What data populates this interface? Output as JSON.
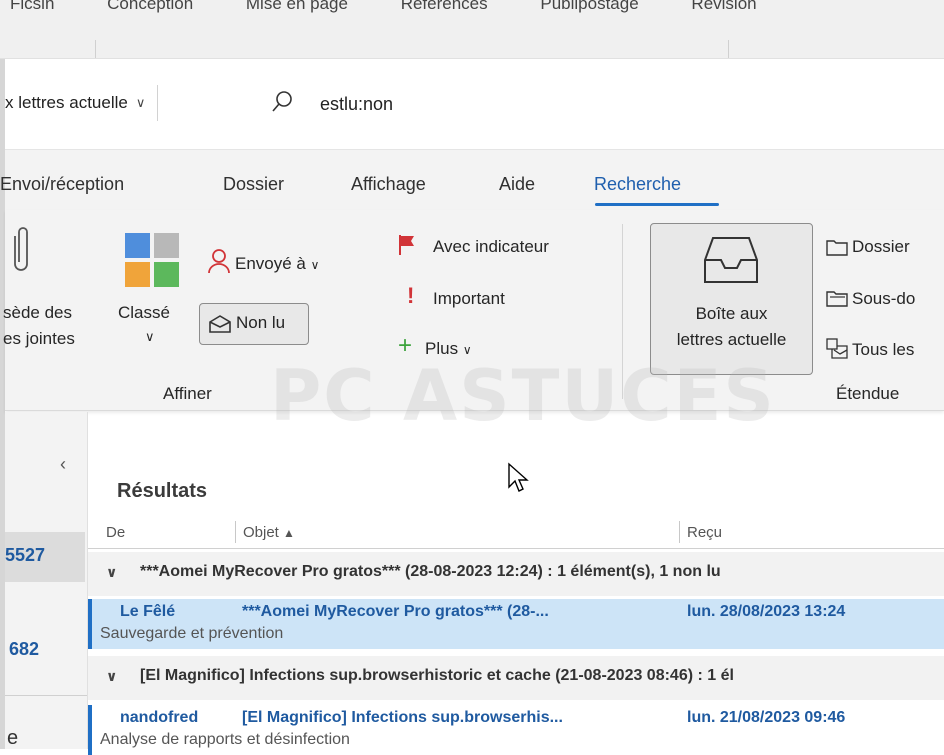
{
  "top_tabs_partial": [
    "Ficsin",
    "Conception",
    "Mise en page",
    "Références",
    "Publipostage",
    "Révision"
  ],
  "search": {
    "scope": "x lettres actuelle",
    "query": "estlu:non"
  },
  "ribbon_tabs": [
    {
      "label": "Envoi/réception",
      "active": false
    },
    {
      "label": "Dossier",
      "active": false
    },
    {
      "label": "Affichage",
      "active": false
    },
    {
      "label": "Aide",
      "active": false
    },
    {
      "label": "Recherche",
      "active": true
    }
  ],
  "ribbon": {
    "attachments_line1": "sède des",
    "attachments_line2": "es jointes",
    "categorized": "Classé",
    "sent_to": "Envoyé à",
    "unread": "Non lu",
    "flagged": "Avec indicateur",
    "important": "Important",
    "more": "Plus",
    "refine_group": "Affiner",
    "mailbox_line1": "Boîte aux",
    "mailbox_line2": "lettres actuelle",
    "folder": "Dossier",
    "subfolders": "Sous-do",
    "all": "Tous les",
    "scope_group": "Étendue"
  },
  "nav": {
    "collapse": "‹",
    "count1": "5527",
    "count2": "682",
    "letter": "e"
  },
  "results": {
    "title": "Résultats",
    "columns": {
      "from": "De",
      "subject": "Objet",
      "received": "Reçu"
    },
    "groups": [
      {
        "header": "***Aomei MyRecover Pro gratos*** (28-08-2023 12:24) : 1 élément(s), 1 non lu",
        "item": {
          "from": "Le Fêlé",
          "subject": "***Aomei MyRecover Pro gratos*** (28-...",
          "date": "lun. 28/08/2023 13:24",
          "folder": "Sauvegarde et prévention",
          "selected": true
        }
      },
      {
        "header": "[El Magnifico] Infections sup.browserhistoric et cache (21-08-2023 08:46) : 1 él",
        "item": {
          "from": "nandofred",
          "subject": "[El Magnifico] Infections sup.browserhis...",
          "date": "lun. 21/08/2023 09:46",
          "folder": "Analyse de rapports et désinfection",
          "selected": false
        }
      }
    ]
  },
  "watermark": "PC ASTUCES",
  "colors": {
    "accent": "#1f6fc5",
    "selected_row": "#cde4f7",
    "ribbon_bg": "#f3f3f3"
  }
}
